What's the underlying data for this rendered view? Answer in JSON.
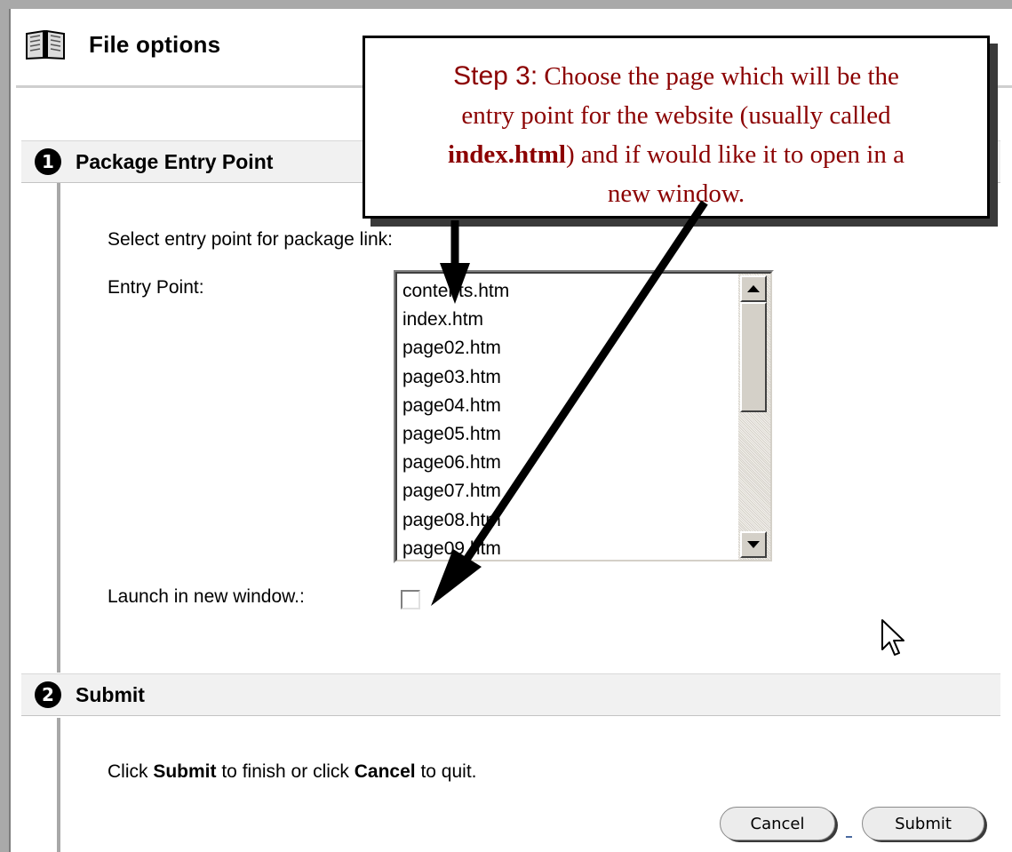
{
  "page": {
    "title": "File options"
  },
  "callout": {
    "step_label": "Step 3:",
    "line1_rest": " Choose the page which will be the",
    "line2": "entry point for the website (usually called",
    "line3_bold": "index.html",
    "line3_rest": ") and if would like it to open in a",
    "line4": "new window."
  },
  "section1": {
    "number": "1",
    "title": "Package Entry Point",
    "instruction": "Select entry point for package link:",
    "entry_point_label": "Entry Point:",
    "files": [
      "contents.htm",
      "index.htm",
      "page02.htm",
      "page03.htm",
      "page04.htm",
      "page05.htm",
      "page06.htm",
      "page07.htm",
      "page08.htm",
      "page09.htm"
    ],
    "launch_label": "Launch in new window.:",
    "launch_checked": false
  },
  "section2": {
    "number": "2",
    "title": "Submit",
    "instr_pre": "Click ",
    "instr_submit": "Submit",
    "instr_mid": " to finish or click ",
    "instr_cancel": "Cancel",
    "instr_post": " to quit."
  },
  "buttons": {
    "cancel": "Cancel",
    "submit": "Submit"
  },
  "icons": {
    "header": "open-book-icon",
    "cursor": "mouse-pointer-icon"
  },
  "colors": {
    "callout_text": "#8b0000",
    "section_bar": "#f1f1f1"
  }
}
